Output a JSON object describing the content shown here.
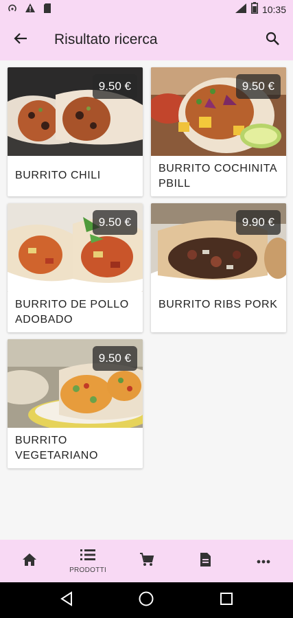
{
  "status_bar": {
    "time": "10:35",
    "left_icons": [
      "hotspot-icon",
      "warning-icon",
      "sim-card-icon"
    ],
    "right_icons": [
      "signal-icon",
      "battery-icon"
    ]
  },
  "app_bar": {
    "title": "Risultato ricerca",
    "back_icon": "arrow-back-icon",
    "search_icon": "search-icon"
  },
  "products": [
    {
      "name": "BURRITO CHILI",
      "price": "9.50 €"
    },
    {
      "name": "BURRITO COCHINITA PBILL",
      "price": "9.50 €"
    },
    {
      "name": "BURRITO DE POLLO ADOBADO",
      "price": "9.50 €"
    },
    {
      "name": "BURRITO RIBS PORK",
      "price": "9.90 €"
    },
    {
      "name": "BURRITO VEGETARIANO",
      "price": "9.50 €"
    }
  ],
  "bottom_nav": {
    "items": [
      {
        "icon": "home-icon",
        "label": ""
      },
      {
        "icon": "list-icon",
        "label": "PRODOTTI"
      },
      {
        "icon": "cart-icon",
        "label": ""
      },
      {
        "icon": "document-icon",
        "label": ""
      },
      {
        "icon": "more-icon",
        "label": ""
      }
    ]
  },
  "colors": {
    "accent": "#f8d9f4",
    "background": "#f6f6f6",
    "badge": "#3a3a3a"
  }
}
